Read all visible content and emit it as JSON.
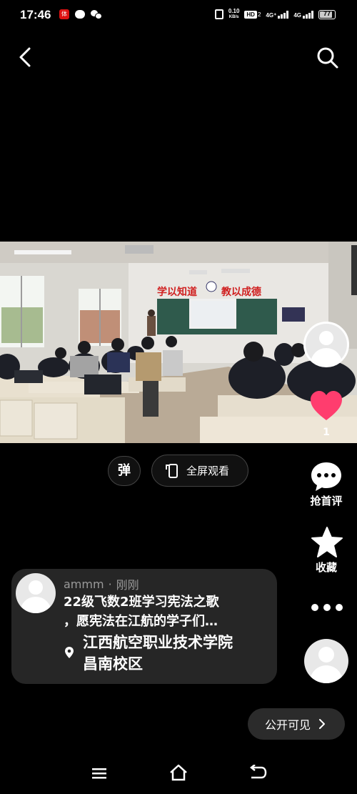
{
  "status_bar": {
    "time": "17:46",
    "app_badge": "体",
    "net_speed_value": "0.10",
    "net_speed_unit": "KB/s",
    "hd_badge": "HD",
    "hd_sub": "2",
    "signal_1": "4G⁺",
    "signal_2": "4G",
    "battery": "77",
    "battery_level": 0.77
  },
  "video": {
    "banner_left": "学以知道",
    "banner_right": "教以成德"
  },
  "controls": {
    "danmaku_label": "弹",
    "fullscreen_label": "全屏观看"
  },
  "right_rail": {
    "like_count": "1",
    "comment_label": "抢首评",
    "favorite_label": "收藏"
  },
  "post": {
    "author": "ammm",
    "separator": "·",
    "time": "刚刚",
    "title_line1": "22级飞数2班学习宪法之歌",
    "title_line2": "，愿宪法在江航的学子们…",
    "location_line1": "江西航空职业技术学院",
    "location_line2": "昌南校区"
  },
  "visibility": {
    "label": "公开可见"
  },
  "colors": {
    "background": "#000000",
    "like": "#ff3d6e",
    "card": "#262626"
  }
}
